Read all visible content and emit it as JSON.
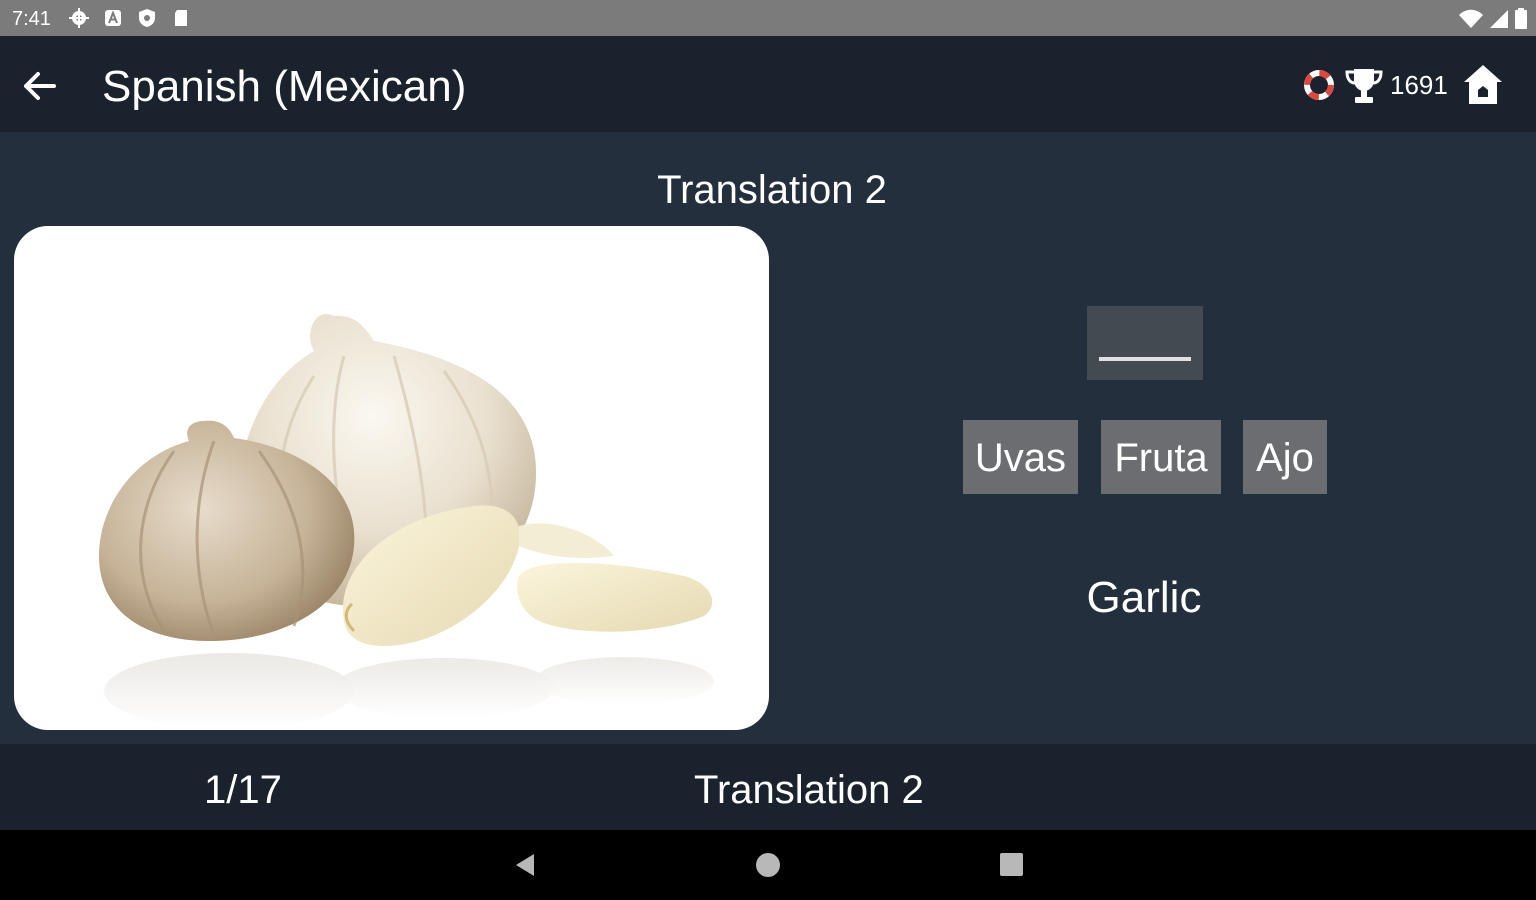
{
  "status_bar": {
    "time": "7:41",
    "left_icons": [
      "settings-icon",
      "a-icon",
      "shield-icon",
      "sdcard-icon"
    ],
    "right_icons": [
      "wifi-icon",
      "signal-icon",
      "battery-icon"
    ]
  },
  "app_bar": {
    "title": "Spanish (Mexican)",
    "score": "1691",
    "icons": [
      "back-arrow-icon",
      "ring-icon",
      "trophy-icon",
      "home-icon"
    ]
  },
  "exercise": {
    "title": "Translation 2",
    "image": "garlic-photo",
    "answer_slot": "",
    "choices": [
      "Uvas",
      "Fruta",
      "Ajo"
    ],
    "word": "Garlic"
  },
  "footer": {
    "counter": "1/17",
    "title": "Translation 2"
  },
  "colors": {
    "background": "#232f3d",
    "bar": "#19222d",
    "choice": "#6b6d70",
    "slot": "#434a52",
    "accent_red": "#e2453c"
  }
}
